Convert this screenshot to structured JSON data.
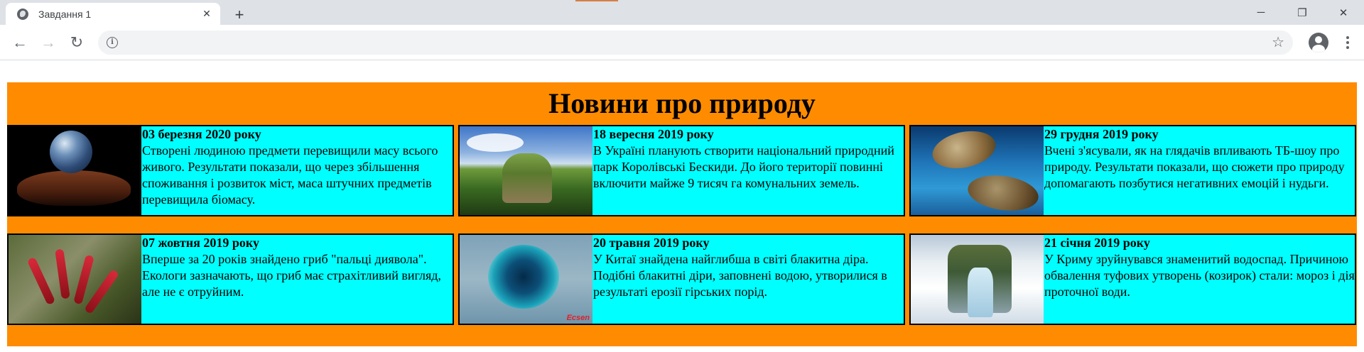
{
  "browser": {
    "tab_title": "Завдання 1",
    "tab_close_glyph": "✕",
    "new_tab_glyph": "+",
    "back_glyph": "←",
    "forward_glyph": "→",
    "reload_glyph": "↻",
    "address": "",
    "star_glyph": "☆",
    "minimize_glyph": "─",
    "restore_glyph": "❐",
    "close_glyph": "✕"
  },
  "page": {
    "title": "Новини про природу",
    "background_color": "#ff8c00",
    "card_color": "#00ffff",
    "news": [
      {
        "date": "03 березня 2020 року",
        "text": "Створені людиною предмети перевищили масу всього живого. Результати показали, що через збільшення споживання і розвиток міст, маса штучних предметів перевищила біомасу.",
        "image": "earth-in-hands-image"
      },
      {
        "date": "18 вересня 2019 року",
        "text": "В Україні планують створити національний природний парк Королівські Бескиди. До його території повинні включити майже 9 тисяч га комунальних земель.",
        "image": "mountain-landscape-image"
      },
      {
        "date": "29 грудня 2019 року",
        "text": "Вчені з'ясували, як на глядачів впливають ТБ-шоу про природу. Результати показали, що сюжети про природу допомагають позбутися негативних емоцій і нудьги.",
        "image": "sea-turtles-image"
      },
      {
        "date": "07 жовтня 2019 року",
        "text": "Вперше за 20 років знайдено гриб \"пальці диявола\". Екологи зазначають, що гриб має страхітливий вигляд, але не є отруйним.",
        "image": "devils-fingers-fungus-image"
      },
      {
        "date": "20 травня 2019 року",
        "text": "У Китаї знайдена найглибша в світі блакитна діра. Подібні блакитні діри, заповнені водою, утворилися в результаті ерозії гірських порід.",
        "image": "blue-hole-image",
        "image_mark": "Ecsen"
      },
      {
        "date": "21 січня 2019 року",
        "text": "У Криму зруйнувався знаменитий водоспад. Причиною обвалення туфових утворень (козирок) стали: мороз і дія проточної води.",
        "image": "frozen-waterfall-image"
      }
    ]
  }
}
